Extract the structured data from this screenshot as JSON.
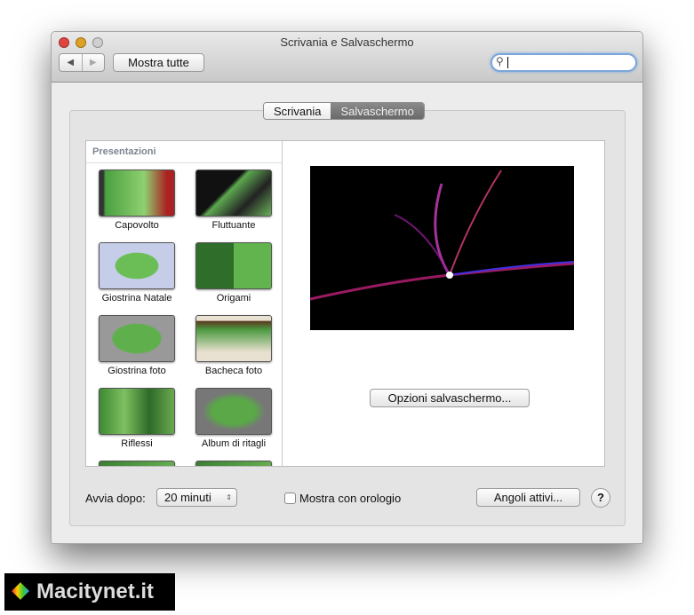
{
  "window": {
    "title": "Scrivania e Salvaschermo"
  },
  "toolbar": {
    "back": "◀",
    "forward": "▶",
    "show_all": "Mostra tutte",
    "search_placeholder": ""
  },
  "tabs": [
    {
      "label": "Scrivania",
      "selected": false
    },
    {
      "label": "Salvaschermo",
      "selected": true
    }
  ],
  "sidebar": {
    "header": "Presentazioni",
    "items": [
      "Capovolto",
      "Fluttuante",
      "Giostrina Natale",
      "Origami",
      "Giostrina foto",
      "Bacheca foto",
      "Riflessi",
      "Album di ritagli"
    ]
  },
  "preview": {
    "options_button": "Opzioni salvaschermo..."
  },
  "bottom": {
    "start_after_label": "Avvia dopo:",
    "start_after_value": "20 minuti",
    "show_clock_label": "Mostra con orologio",
    "show_clock_checked": false,
    "hot_corners": "Angoli attivi...",
    "help": "?"
  },
  "watermark": "Macitynet.it"
}
